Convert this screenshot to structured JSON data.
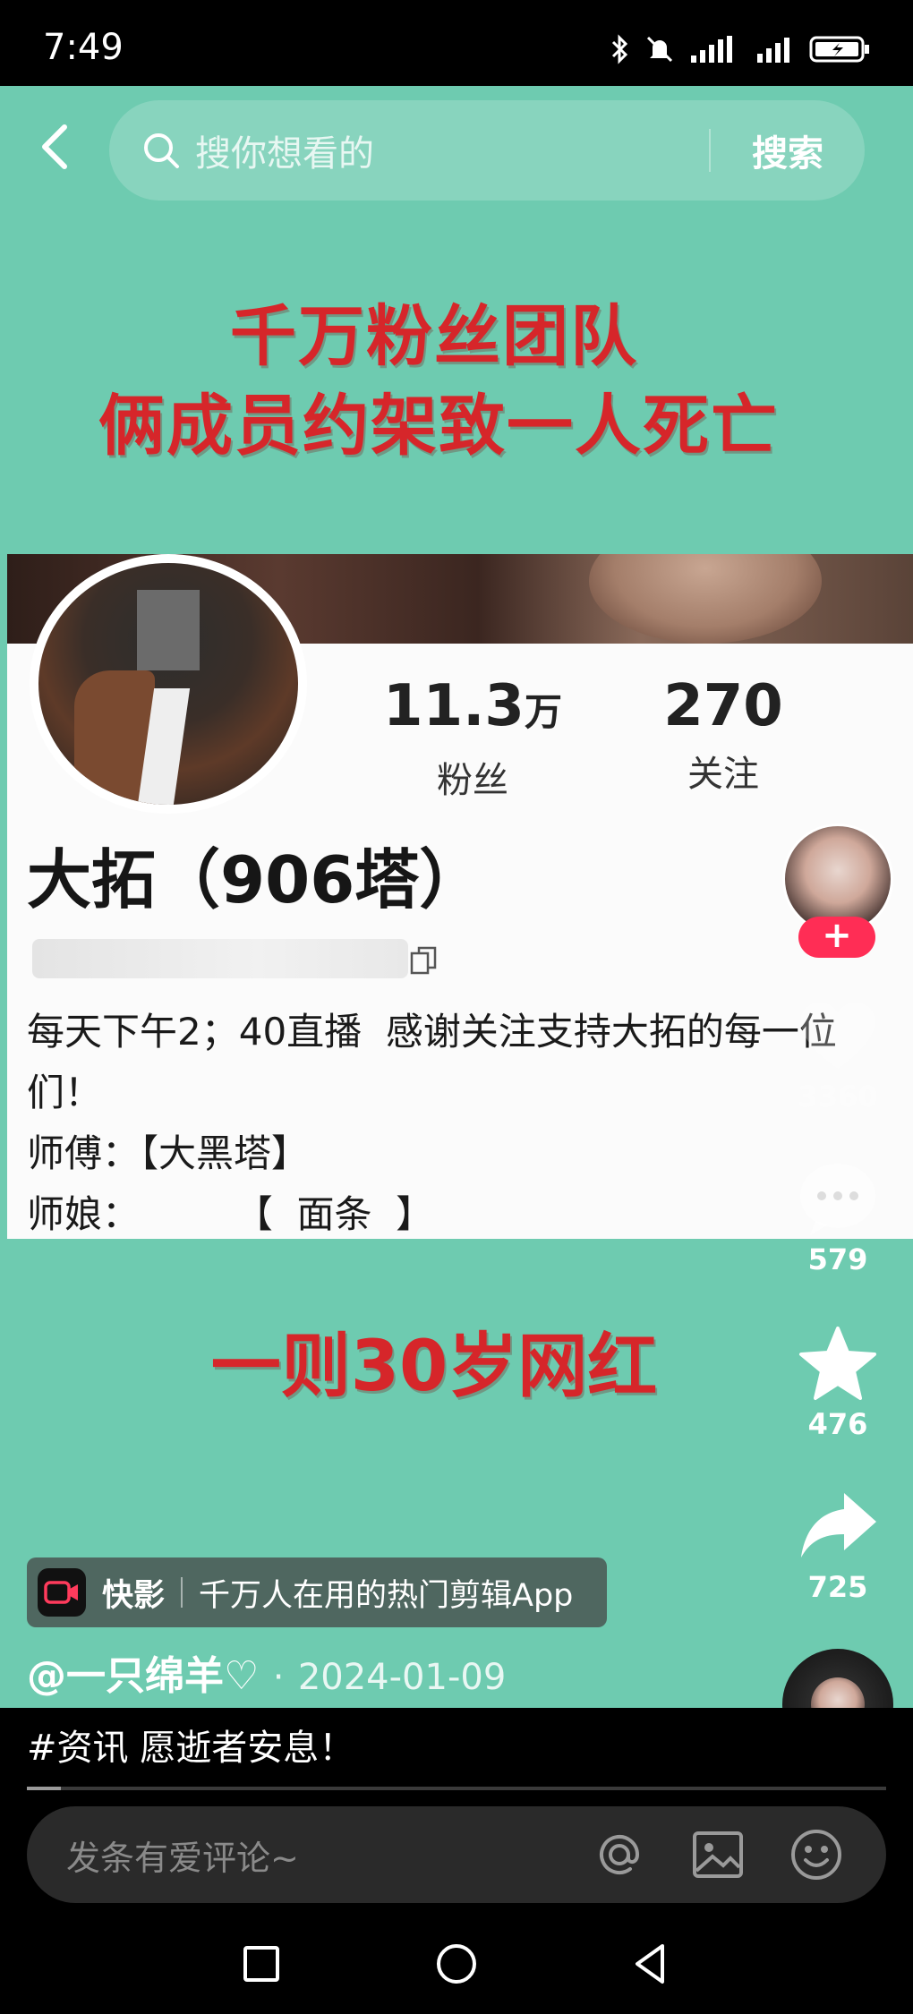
{
  "status_bar": {
    "time": "7:49",
    "icons": [
      "bluetooth-icon",
      "mute-icon",
      "signal-icon",
      "signal-icon",
      "battery-charging-icon"
    ]
  },
  "search": {
    "placeholder": "搜你想看的",
    "submit_label": "搜索"
  },
  "video": {
    "headline_line1": "千万粉丝团队",
    "headline_line2": "俩成员约架致一人死亡",
    "subtitle": "一则30岁网红",
    "profile": {
      "followers_value": "11.3",
      "followers_unit": "万",
      "followers_label": "粉丝",
      "following_value": "270",
      "following_label": "关注",
      "name": "大拓（906塔）",
      "bio": "每天下午2；40直播  感谢关注支持大拓的每一位\n们！\n师傅：【大黑塔】\n师娘：        【  面条  】"
    }
  },
  "side_actions": {
    "follow_label": "+",
    "like_count": "3360",
    "comment_count": "579",
    "favorite_count": "476",
    "share_count": "725"
  },
  "ad": {
    "app_name": "快影",
    "tagline": "千万人在用的热门剪辑App"
  },
  "author": {
    "handle": "@一只绵羊♡",
    "separator": "·",
    "date": "2024-01-09"
  },
  "description": "#资讯 愿逝者安息！",
  "playback": {
    "progress": 0.04
  },
  "comment": {
    "placeholder": "发条有爱评论~"
  },
  "colors": {
    "background_teal": "#6ecbb0",
    "headline_red": "#d6262a",
    "follow_pink": "#ff2d55"
  }
}
